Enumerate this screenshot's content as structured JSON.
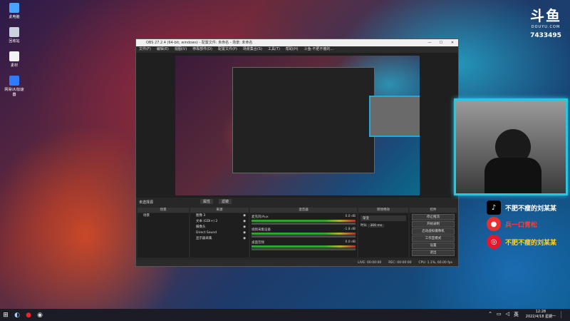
{
  "desktop": {
    "icons": [
      {
        "label": "此电脑",
        "name": "this-pc"
      },
      {
        "label": "回收站",
        "name": "recycle-bin"
      },
      {
        "label": "素材",
        "name": "material-folder"
      },
      {
        "label": "网易UU加速器",
        "name": "uu-accelerator"
      }
    ]
  },
  "obs": {
    "title": "OBS 27.2.4 (64-bit, windows) - 配置文件: 未命名 - 场景: 未命名",
    "menu": [
      "文件(F)",
      "编辑(E)",
      "视图(V)",
      "停靠部件(D)",
      "配置文件(P)",
      "场景集合(S)",
      "工具(T)",
      "帮助(H)",
      "斗鱼-不肥不瘦的..."
    ],
    "no_source": "未选择源",
    "props_button": "属性",
    "filters_button": "滤镜",
    "docks": {
      "scenes": {
        "title": "场景",
        "items": [
          "场景"
        ]
      },
      "sources": {
        "title": "来源",
        "items": [
          "图像 3",
          "文本 (GDI+) 2",
          "摄像头",
          "Direct Sound",
          "显示器采集"
        ]
      },
      "mixer": {
        "title": "混音器",
        "channels": [
          {
            "name": "麦克风/Aux",
            "db": "0.0 dB"
          },
          {
            "name": "视频采集设备",
            "db": "-1.8 dB"
          },
          {
            "name": "桌面音频",
            "db": "0.0 dB"
          }
        ]
      },
      "transitions": {
        "title": "转场特效",
        "type": "渐变",
        "duration_label": "时长",
        "duration": "300 ms"
      },
      "controls": {
        "title": "控件",
        "buttons": [
          "停止推流",
          "开始录制",
          "启动虚拟摄像机",
          "工作室模式",
          "设置",
          "退出"
        ]
      }
    },
    "status": {
      "live": "LIVE: 00:00:00",
      "rec": "REC: 00:00:00",
      "cpu": "CPU: 1.1%, 60.00 fps"
    }
  },
  "overlay": {
    "brand": "斗鱼",
    "brand_sub": "DOUYU.COM",
    "room_id": "7433495",
    "socials": [
      {
        "icon": "tiktok-icon",
        "label": "不肥不瘦的刘某某",
        "color": "#ffffff",
        "bg": "#000000"
      },
      {
        "icon": "pingpong-icon",
        "label": "兵一口青松",
        "color": "#ff3b3b",
        "bg": "#e83030"
      },
      {
        "icon": "weibo-icon",
        "label": "不肥不瘦的刘某某",
        "color": "#ffd21f",
        "bg": "#e6162d"
      }
    ],
    "accent": "#29c6e0"
  },
  "taskbar": {
    "time": "12:28",
    "date": "2022/4/18 星期一"
  }
}
